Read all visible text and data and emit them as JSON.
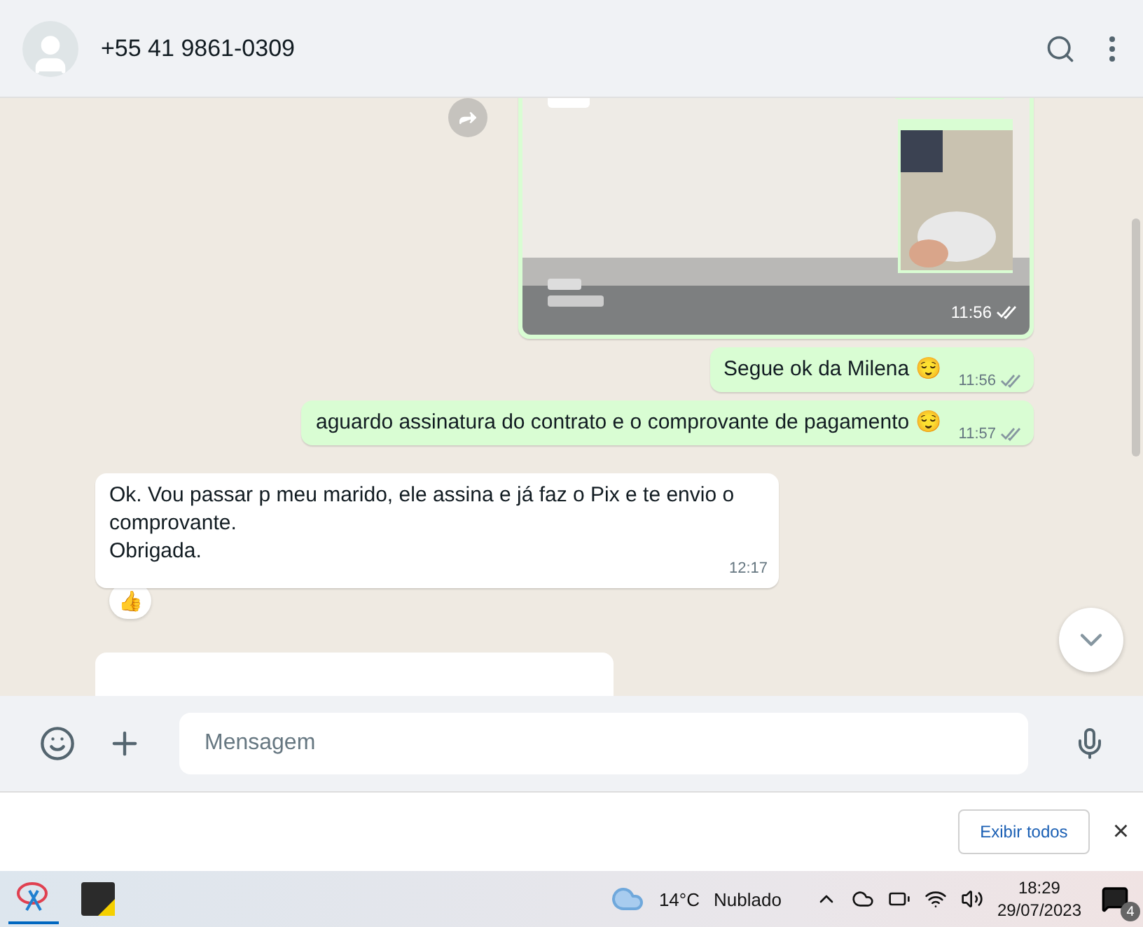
{
  "header": {
    "contact": "+55 41 9861-0309"
  },
  "messages": [
    {
      "outgoing": true,
      "time": "11:56",
      "read": false,
      "forwardable": true
    },
    {
      "kind": "text",
      "outgoing": true,
      "text": "Segue ok da Milena 😌",
      "time": "11:56",
      "read": false
    },
    {
      "kind": "text",
      "outgoing": true,
      "text": "aguardo assinatura do contrato e o comprovante de pagamento 😌",
      "time": "11:57",
      "read": false
    },
    {
      "kind": "text",
      "outgoing": false,
      "lines": [
        "Ok. Vou passar p meu marido, ele assina e já faz o Pix e te envio o comprovante.",
        "Obrigada."
      ],
      "time": "12:17",
      "reaction": "👍"
    },
    {
      "kind": "blank",
      "outgoing": false
    }
  ],
  "composer": {
    "placeholder": "Mensagem"
  },
  "notification": {
    "button": "Exibir todos",
    "close": "×"
  },
  "taskbar": {
    "weather": "14°C",
    "condition": "Nublado",
    "time": "18:29",
    "date": "29/07/2023",
    "notifications": "4"
  }
}
